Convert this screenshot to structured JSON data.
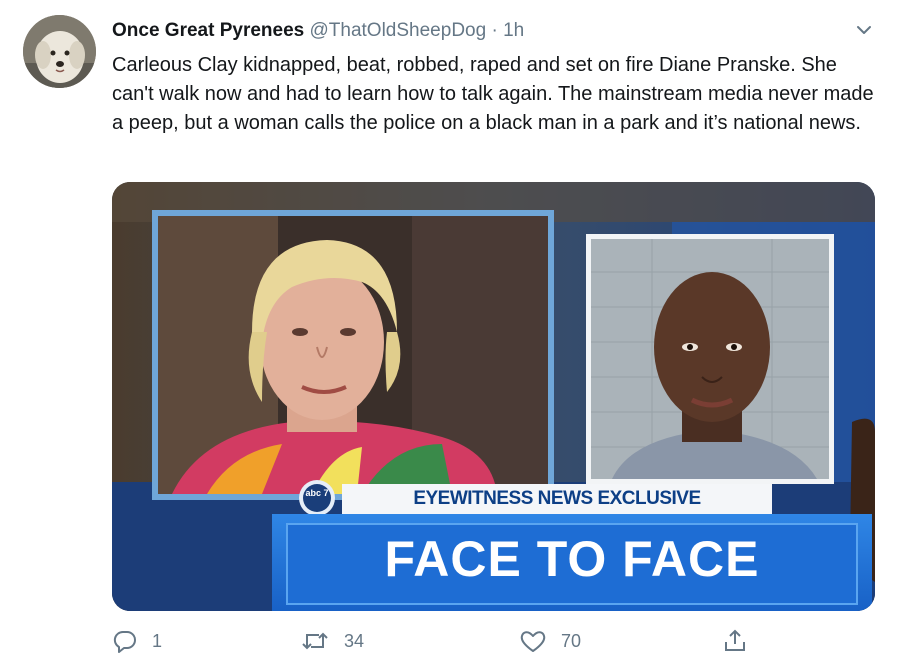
{
  "tweet": {
    "display_name": "Once Great Pyrenees",
    "handle": "@ThatOldSheepDog",
    "separator": "·",
    "time": "1h",
    "text": "Carleous Clay kidnapped, beat, robbed, raped and set on fire Diane Pranske. She can't walk now and had to learn how to talk again. The mainstream media never made a peep, but a woman calls the police on a black man in a park and it’s national news."
  },
  "media": {
    "station_logo": "abc 7",
    "banner_text": "EYEWITNESS NEWS EXCLUSIVE",
    "headline_text": "FACE TO FACE"
  },
  "actions": {
    "reply_count": "1",
    "retweet_count": "34",
    "like_count": "70"
  },
  "icons": {
    "caret": "chevron-down-icon",
    "reply": "reply-icon",
    "retweet": "retweet-icon",
    "like": "heart-icon",
    "share": "share-icon"
  },
  "colors": {
    "text": "#14171a",
    "secondary": "#657786",
    "news_blue": "#1a6fd1",
    "banner_dark": "#0d3f86"
  }
}
